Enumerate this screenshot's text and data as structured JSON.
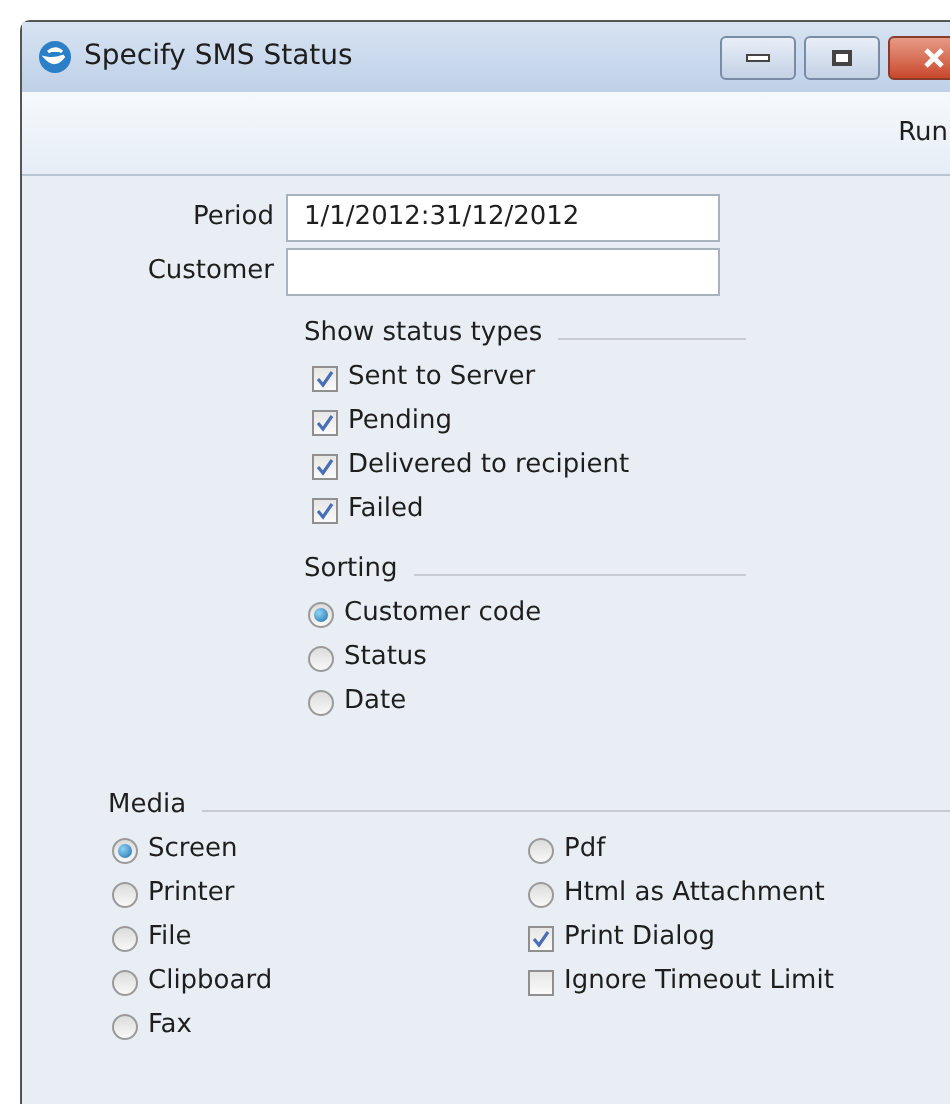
{
  "window": {
    "title": "Specify SMS Status"
  },
  "toolbar": {
    "buttons": [
      "Run"
    ]
  },
  "fields": [
    {
      "label": "Period",
      "value": "1/1/2012:31/12/2012"
    },
    {
      "label": "Customer"
    }
  ],
  "status_types": {
    "title": "Show status types",
    "items": [
      {
        "label": "Sent to Server",
        "checked": true
      },
      {
        "label": "Pending",
        "checked": true
      },
      {
        "label": "Delivered to recipient",
        "checked": true
      },
      {
        "label": "Failed",
        "checked": true
      }
    ]
  },
  "sorting": {
    "title": "Sorting",
    "options": [
      {
        "label": "Customer code",
        "selected": true
      },
      {
        "label": "Status",
        "selected": false
      },
      {
        "label": "Date",
        "selected": false
      }
    ]
  },
  "media": {
    "title": "Media",
    "column_1": [
      {
        "kind": "radio",
        "label": "Screen",
        "selected": true
      },
      {
        "kind": "radio",
        "label": "Printer",
        "selected": false
      },
      {
        "kind": "radio",
        "label": "File",
        "selected": false
      },
      {
        "kind": "radio",
        "label": "Clipboard",
        "selected": false
      },
      {
        "kind": "radio",
        "label": "Fax",
        "selected": false
      }
    ],
    "column_2": [
      {
        "kind": "radio",
        "label": "Pdf",
        "selected": false
      },
      {
        "kind": "radio",
        "label": "Html as Attachment",
        "selected": false
      },
      {
        "kind": "checkbox",
        "label": "Print Dialog",
        "checked": true
      },
      {
        "kind": "checkbox",
        "label": "Ignore Timeout Limit",
        "checked": false
      }
    ]
  }
}
